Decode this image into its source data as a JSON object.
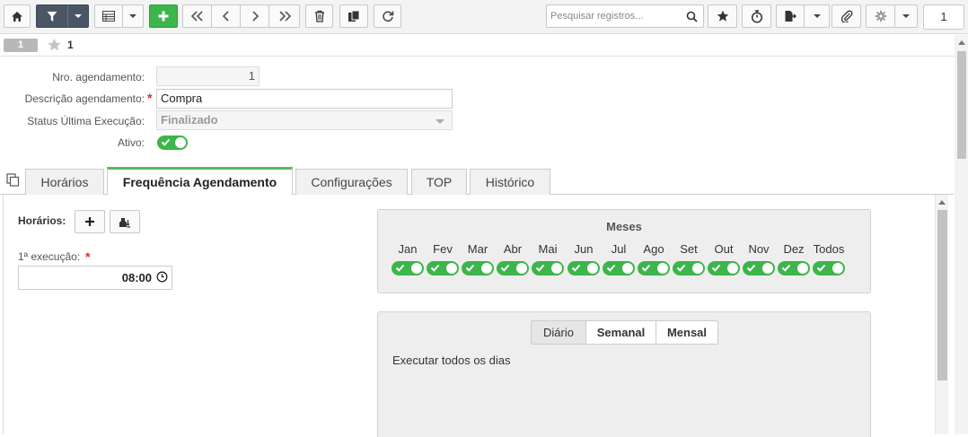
{
  "toolbar": {
    "search_placeholder": "Pesquisar registros...",
    "page_number": "1"
  },
  "record_bar": {
    "record_index": "1",
    "record_title": "1"
  },
  "form": {
    "nro_label": "Nro. agendamento:",
    "nro_value": "1",
    "descricao_label": "Descrição agendamento:",
    "descricao_value": "Compra",
    "status_label": "Status Última Execução:",
    "status_value": "Finalizado",
    "ativo_label": "Ativo:",
    "ativo_on": true
  },
  "tabs": [
    {
      "label": "Horários"
    },
    {
      "label": "Frequência Agendamento"
    },
    {
      "label": "Configurações"
    },
    {
      "label": "TOP"
    },
    {
      "label": "Histórico"
    }
  ],
  "active_tab": "Frequência Agendamento",
  "frequencia": {
    "horarios_label": "Horários:",
    "primeira_execucao_label": "1ª execução:",
    "primeira_execucao_value": "08:00",
    "meses_title": "Meses",
    "months": [
      "Jan",
      "Fev",
      "Mar",
      "Abr",
      "Mai",
      "Jun",
      "Jul",
      "Ago",
      "Set",
      "Out",
      "Nov",
      "Dez",
      "Todos"
    ],
    "months_on": [
      true,
      true,
      true,
      true,
      true,
      true,
      true,
      true,
      true,
      true,
      true,
      true,
      true
    ],
    "periodicity_tabs": [
      "Diário",
      "Semanal",
      "Mensal"
    ],
    "periodicity_active": "Diário",
    "diario_text": "Executar todos os dias"
  },
  "colors": {
    "accent_green": "#3cb54a",
    "dark_button": "#4a5566",
    "required_red": "#d9302c"
  }
}
